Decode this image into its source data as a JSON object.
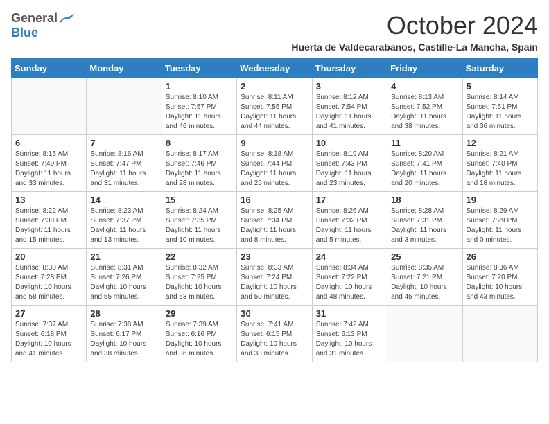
{
  "header": {
    "logo_general": "General",
    "logo_blue": "Blue",
    "month": "October 2024",
    "location": "Huerta de Valdecarabanos, Castille-La Mancha, Spain"
  },
  "days_of_week": [
    "Sunday",
    "Monday",
    "Tuesday",
    "Wednesday",
    "Thursday",
    "Friday",
    "Saturday"
  ],
  "weeks": [
    [
      {
        "day": "",
        "info": ""
      },
      {
        "day": "",
        "info": ""
      },
      {
        "day": "1",
        "info": "Sunrise: 8:10 AM\nSunset: 7:57 PM\nDaylight: 11 hours and 46 minutes."
      },
      {
        "day": "2",
        "info": "Sunrise: 8:11 AM\nSunset: 7:55 PM\nDaylight: 11 hours and 44 minutes."
      },
      {
        "day": "3",
        "info": "Sunrise: 8:12 AM\nSunset: 7:54 PM\nDaylight: 11 hours and 41 minutes."
      },
      {
        "day": "4",
        "info": "Sunrise: 8:13 AM\nSunset: 7:52 PM\nDaylight: 11 hours and 38 minutes."
      },
      {
        "day": "5",
        "info": "Sunrise: 8:14 AM\nSunset: 7:51 PM\nDaylight: 11 hours and 36 minutes."
      }
    ],
    [
      {
        "day": "6",
        "info": "Sunrise: 8:15 AM\nSunset: 7:49 PM\nDaylight: 11 hours and 33 minutes."
      },
      {
        "day": "7",
        "info": "Sunrise: 8:16 AM\nSunset: 7:47 PM\nDaylight: 11 hours and 31 minutes."
      },
      {
        "day": "8",
        "info": "Sunrise: 8:17 AM\nSunset: 7:46 PM\nDaylight: 11 hours and 28 minutes."
      },
      {
        "day": "9",
        "info": "Sunrise: 8:18 AM\nSunset: 7:44 PM\nDaylight: 11 hours and 25 minutes."
      },
      {
        "day": "10",
        "info": "Sunrise: 8:19 AM\nSunset: 7:43 PM\nDaylight: 11 hours and 23 minutes."
      },
      {
        "day": "11",
        "info": "Sunrise: 8:20 AM\nSunset: 7:41 PM\nDaylight: 11 hours and 20 minutes."
      },
      {
        "day": "12",
        "info": "Sunrise: 8:21 AM\nSunset: 7:40 PM\nDaylight: 11 hours and 18 minutes."
      }
    ],
    [
      {
        "day": "13",
        "info": "Sunrise: 8:22 AM\nSunset: 7:38 PM\nDaylight: 11 hours and 15 minutes."
      },
      {
        "day": "14",
        "info": "Sunrise: 8:23 AM\nSunset: 7:37 PM\nDaylight: 11 hours and 13 minutes."
      },
      {
        "day": "15",
        "info": "Sunrise: 8:24 AM\nSunset: 7:35 PM\nDaylight: 11 hours and 10 minutes."
      },
      {
        "day": "16",
        "info": "Sunrise: 8:25 AM\nSunset: 7:34 PM\nDaylight: 11 hours and 8 minutes."
      },
      {
        "day": "17",
        "info": "Sunrise: 8:26 AM\nSunset: 7:32 PM\nDaylight: 11 hours and 5 minutes."
      },
      {
        "day": "18",
        "info": "Sunrise: 8:28 AM\nSunset: 7:31 PM\nDaylight: 11 hours and 3 minutes."
      },
      {
        "day": "19",
        "info": "Sunrise: 8:29 AM\nSunset: 7:29 PM\nDaylight: 11 hours and 0 minutes."
      }
    ],
    [
      {
        "day": "20",
        "info": "Sunrise: 8:30 AM\nSunset: 7:28 PM\nDaylight: 10 hours and 58 minutes."
      },
      {
        "day": "21",
        "info": "Sunrise: 8:31 AM\nSunset: 7:26 PM\nDaylight: 10 hours and 55 minutes."
      },
      {
        "day": "22",
        "info": "Sunrise: 8:32 AM\nSunset: 7:25 PM\nDaylight: 10 hours and 53 minutes."
      },
      {
        "day": "23",
        "info": "Sunrise: 8:33 AM\nSunset: 7:24 PM\nDaylight: 10 hours and 50 minutes."
      },
      {
        "day": "24",
        "info": "Sunrise: 8:34 AM\nSunset: 7:22 PM\nDaylight: 10 hours and 48 minutes."
      },
      {
        "day": "25",
        "info": "Sunrise: 8:35 AM\nSunset: 7:21 PM\nDaylight: 10 hours and 45 minutes."
      },
      {
        "day": "26",
        "info": "Sunrise: 8:36 AM\nSunset: 7:20 PM\nDaylight: 10 hours and 43 minutes."
      }
    ],
    [
      {
        "day": "27",
        "info": "Sunrise: 7:37 AM\nSunset: 6:18 PM\nDaylight: 10 hours and 41 minutes."
      },
      {
        "day": "28",
        "info": "Sunrise: 7:38 AM\nSunset: 6:17 PM\nDaylight: 10 hours and 38 minutes."
      },
      {
        "day": "29",
        "info": "Sunrise: 7:39 AM\nSunset: 6:16 PM\nDaylight: 10 hours and 36 minutes."
      },
      {
        "day": "30",
        "info": "Sunrise: 7:41 AM\nSunset: 6:15 PM\nDaylight: 10 hours and 33 minutes."
      },
      {
        "day": "31",
        "info": "Sunrise: 7:42 AM\nSunset: 6:13 PM\nDaylight: 10 hours and 31 minutes."
      },
      {
        "day": "",
        "info": ""
      },
      {
        "day": "",
        "info": ""
      }
    ]
  ]
}
